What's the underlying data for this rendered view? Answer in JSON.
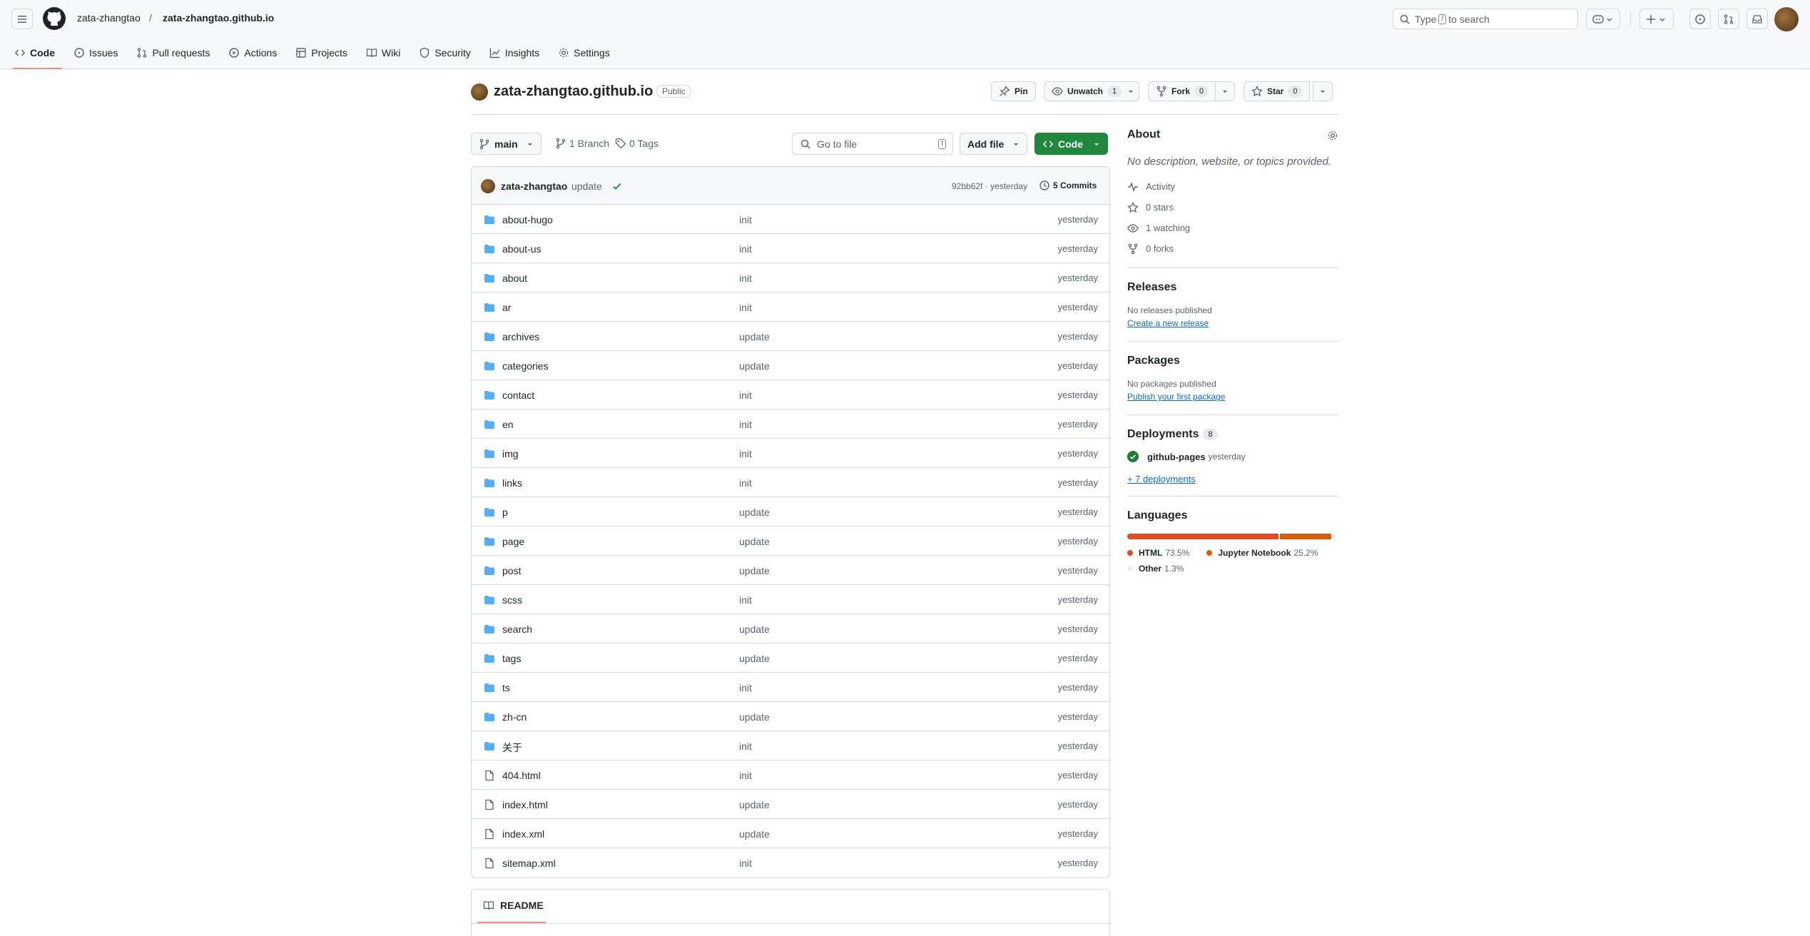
{
  "header": {
    "owner": "zata-zhangtao",
    "separator": "/",
    "repo": "zata-zhangtao.github.io",
    "search_pre": "Type",
    "search_key": "/",
    "search_post": "to search"
  },
  "nav": {
    "tabs": [
      {
        "label": "Code",
        "icon": "code-icon"
      },
      {
        "label": "Issues",
        "icon": "issue-icon"
      },
      {
        "label": "Pull requests",
        "icon": "pull-request-icon"
      },
      {
        "label": "Actions",
        "icon": "play-icon"
      },
      {
        "label": "Projects",
        "icon": "table-icon"
      },
      {
        "label": "Wiki",
        "icon": "book-icon"
      },
      {
        "label": "Security",
        "icon": "shield-icon"
      },
      {
        "label": "Insights",
        "icon": "graph-icon"
      },
      {
        "label": "Settings",
        "icon": "gear-icon"
      }
    ]
  },
  "repo": {
    "name": "zata-zhangtao.github.io",
    "visibility": "Public",
    "pin": "Pin",
    "unwatch": "Unwatch",
    "watch_count": "1",
    "fork": "Fork",
    "fork_count": "0",
    "star": "Star",
    "star_count": "0"
  },
  "toolbar": {
    "branch": "main",
    "branches": "1 Branch",
    "tags": "0 Tags",
    "goto_placeholder": "Go to file",
    "goto_key": "t",
    "add_file": "Add file",
    "code": "Code"
  },
  "commit": {
    "author": "zata-zhangtao",
    "message": "update",
    "hash": "92bb62f · yesterday",
    "commits": "5 Commits"
  },
  "files": [
    {
      "name": "about-hugo",
      "msg": "init",
      "time": "yesterday",
      "type": "dir"
    },
    {
      "name": "about-us",
      "msg": "init",
      "time": "yesterday",
      "type": "dir"
    },
    {
      "name": "about",
      "msg": "init",
      "time": "yesterday",
      "type": "dir"
    },
    {
      "name": "ar",
      "msg": "init",
      "time": "yesterday",
      "type": "dir"
    },
    {
      "name": "archives",
      "msg": "update",
      "time": "yesterday",
      "type": "dir"
    },
    {
      "name": "categories",
      "msg": "update",
      "time": "yesterday",
      "type": "dir"
    },
    {
      "name": "contact",
      "msg": "init",
      "time": "yesterday",
      "type": "dir"
    },
    {
      "name": "en",
      "msg": "init",
      "time": "yesterday",
      "type": "dir"
    },
    {
      "name": "img",
      "msg": "init",
      "time": "yesterday",
      "type": "dir"
    },
    {
      "name": "links",
      "msg": "init",
      "time": "yesterday",
      "type": "dir"
    },
    {
      "name": "p",
      "msg": "update",
      "time": "yesterday",
      "type": "dir"
    },
    {
      "name": "page",
      "msg": "update",
      "time": "yesterday",
      "type": "dir"
    },
    {
      "name": "post",
      "msg": "update",
      "time": "yesterday",
      "type": "dir"
    },
    {
      "name": "scss",
      "msg": "init",
      "time": "yesterday",
      "type": "dir"
    },
    {
      "name": "search",
      "msg": "update",
      "time": "yesterday",
      "type": "dir"
    },
    {
      "name": "tags",
      "msg": "update",
      "time": "yesterday",
      "type": "dir"
    },
    {
      "name": "ts",
      "msg": "init",
      "time": "yesterday",
      "type": "dir"
    },
    {
      "name": "zh-cn",
      "msg": "update",
      "time": "yesterday",
      "type": "dir"
    },
    {
      "name": "关于",
      "msg": "init",
      "time": "yesterday",
      "type": "dir"
    },
    {
      "name": "404.html",
      "msg": "init",
      "time": "yesterday",
      "type": "file"
    },
    {
      "name": "index.html",
      "msg": "update",
      "time": "yesterday",
      "type": "file"
    },
    {
      "name": "index.xml",
      "msg": "update",
      "time": "yesterday",
      "type": "file"
    },
    {
      "name": "sitemap.xml",
      "msg": "init",
      "time": "yesterday",
      "type": "file"
    }
  ],
  "readme": {
    "label": "README"
  },
  "about": {
    "title": "About",
    "desc": "No description, website, or topics provided.",
    "activity": "Activity",
    "stars": "0 stars",
    "watching": "1 watching",
    "forks": "0 forks"
  },
  "releases": {
    "title": "Releases",
    "none": "No releases published",
    "link": "Create a new release"
  },
  "packages": {
    "title": "Packages",
    "none": "No packages published",
    "link": "Publish your first package"
  },
  "deployments": {
    "title": "Deployments",
    "count": "8",
    "env": "github-pages",
    "time": "yesterday",
    "more": "+ 7 deployments"
  },
  "languages": {
    "title": "Languages",
    "items": [
      {
        "name": "HTML",
        "pct": "73.5%",
        "value": 73.5,
        "color": "#e34c26"
      },
      {
        "name": "Jupyter Notebook",
        "pct": "25.2%",
        "value": 25.2,
        "color": "#DA5B0B"
      },
      {
        "name": "Other",
        "pct": "1.3%",
        "value": 1.3,
        "color": "#ededed"
      }
    ]
  },
  "colors": {
    "accent": "#0969da",
    "green": "#1f883d",
    "tab_underline": "#fd8c73"
  }
}
